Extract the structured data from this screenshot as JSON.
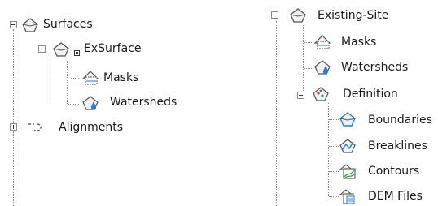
{
  "left_tree": {
    "surfaces": {
      "label": "Surfaces",
      "icon": "surfaces-icon"
    },
    "exsurface": {
      "label": "ExSurface",
      "icon": "surface-icon"
    },
    "masks": {
      "label": "Masks",
      "icon": "masks-icon"
    },
    "watersheds": {
      "label": "Watersheds",
      "icon": "watersheds-icon"
    },
    "alignments": {
      "label": "Alignments",
      "icon": "alignments-icon"
    }
  },
  "right_tree": {
    "existing_site": {
      "label": "Existing-Site",
      "icon": "surface-icon"
    },
    "masks": {
      "label": "Masks",
      "icon": "masks-icon"
    },
    "watersheds": {
      "label": "Watersheds",
      "icon": "watersheds-icon"
    },
    "definition": {
      "label": "Definition",
      "icon": "definition-icon"
    },
    "boundaries": {
      "label": "Boundaries",
      "icon": "boundaries-icon"
    },
    "breaklines": {
      "label": "Breaklines",
      "icon": "breaklines-icon"
    },
    "contours": {
      "label": "Contours",
      "icon": "contours-icon"
    },
    "dem_files": {
      "label": "DEM Files",
      "icon": "dem-files-icon"
    }
  },
  "colors": {
    "tree_line": "#8a8a8a",
    "icon_stroke": "#555555",
    "water_blue": "#2a7ad8",
    "contour_green": "#3aa04a"
  }
}
